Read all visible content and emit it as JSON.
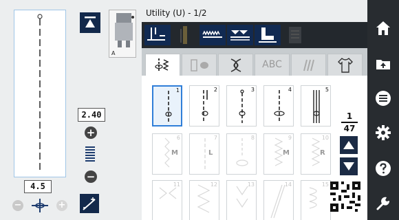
{
  "header": {
    "title": "Utility (U) - 1/2"
  },
  "left_panel": {
    "stitch_width": "2.40",
    "stitch_length": "4.5",
    "width_plus": "+",
    "width_minus": "−",
    "position_minus": "−",
    "position_plus": "+",
    "presser_foot_letter": "A"
  },
  "tabs": [
    {
      "label": "",
      "icon": "utility-stitch-icon",
      "active": true
    },
    {
      "label": "",
      "icon": "buttonhole-icon",
      "active": false
    },
    {
      "label": "",
      "icon": "decorative-stitch-icon",
      "active": false
    },
    {
      "label": "ABC",
      "icon": "",
      "active": false
    },
    {
      "label": "",
      "icon": "quilting-stitch-icon",
      "active": false
    },
    {
      "label": "",
      "icon": "garment-icon",
      "active": false
    }
  ],
  "stitches": [
    {
      "number": "1",
      "enabled": true,
      "selected": true
    },
    {
      "number": "2",
      "enabled": true,
      "selected": false
    },
    {
      "number": "3",
      "enabled": true,
      "selected": false
    },
    {
      "number": "4",
      "enabled": true,
      "selected": false
    },
    {
      "number": "5",
      "enabled": true,
      "selected": false
    },
    {
      "number": "6",
      "letter": "M",
      "enabled": false
    },
    {
      "number": "7",
      "letter": "L",
      "enabled": false
    },
    {
      "number": "8",
      "enabled": false
    },
    {
      "number": "9",
      "letter": "M",
      "enabled": false
    },
    {
      "number": "10",
      "letter": "R",
      "enabled": false
    },
    {
      "number": "11",
      "enabled": false
    },
    {
      "number": "12",
      "enabled": false
    },
    {
      "number": "13",
      "enabled": false
    },
    {
      "number": "14",
      "enabled": false
    },
    {
      "number": "15",
      "enabled": false
    }
  ],
  "pager": {
    "current": "1",
    "total": "47"
  },
  "sidebar": [
    "home-icon",
    "folder-upload-icon",
    "menu-icon",
    "settings-icon",
    "help-icon",
    "wrench-icon"
  ],
  "colors": {
    "accent": "#2f7ed8",
    "navy": "#13294b",
    "sidebar": "#282c30",
    "modebar": "#23282d"
  }
}
